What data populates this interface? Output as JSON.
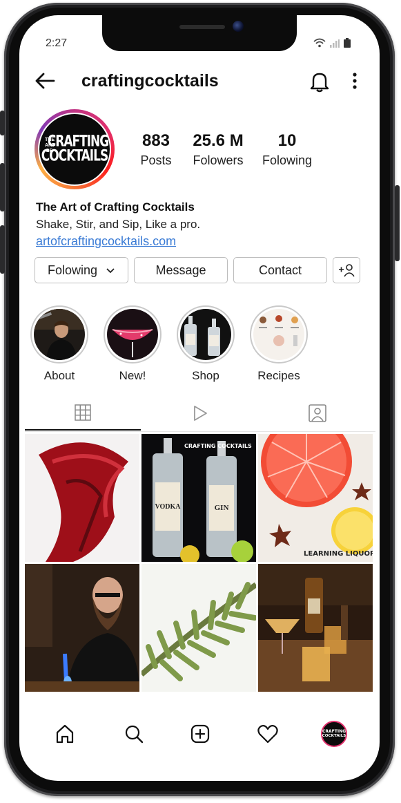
{
  "status": {
    "time": "2:27"
  },
  "header": {
    "username": "craftingcocktails"
  },
  "profile": {
    "avatar_logo": {
      "small": "THE ART OF",
      "line1": "CRAFTING",
      "line2": "COCKTAILS"
    },
    "stats": [
      {
        "value": "883",
        "label": "Posts"
      },
      {
        "value": "25.6 M",
        "label": "Folowers"
      },
      {
        "value": "10",
        "label": "Folowing"
      }
    ],
    "name": "The Art of Crafting Cocktails",
    "bio": "Shake, Stir, and Sip, Like a pro.",
    "link": "artofcraftingcocktails.com"
  },
  "actions": {
    "following": "Folowing",
    "message": "Message",
    "contact": "Contact"
  },
  "highlights": [
    {
      "label": "About"
    },
    {
      "label": "New!"
    },
    {
      "label": "Shop"
    },
    {
      "label": "Recipes"
    }
  ],
  "tabs": [
    "grid-icon",
    "reels-icon",
    "tagged-icon"
  ],
  "posts": [
    {
      "subject": "red wine swirl"
    },
    {
      "subject": "vodka and gin bottles",
      "overlay": "CRAFTING COCKTAILS",
      "labels": [
        "VODKA",
        "GIN"
      ]
    },
    {
      "subject": "grapefruit and star anise",
      "overlay": "LEARNING LIQUOR"
    },
    {
      "subject": "bartender with torch"
    },
    {
      "subject": "rosemary sprig"
    },
    {
      "subject": "cocktails on bar"
    }
  ],
  "bottom_nav": [
    "home-icon",
    "search-icon",
    "create-icon",
    "heart-icon",
    "profile-avatar"
  ],
  "colors": {
    "link": "#3a7bd5",
    "ring_start": "#e1306c",
    "ring_end": "#fcaf45"
  }
}
